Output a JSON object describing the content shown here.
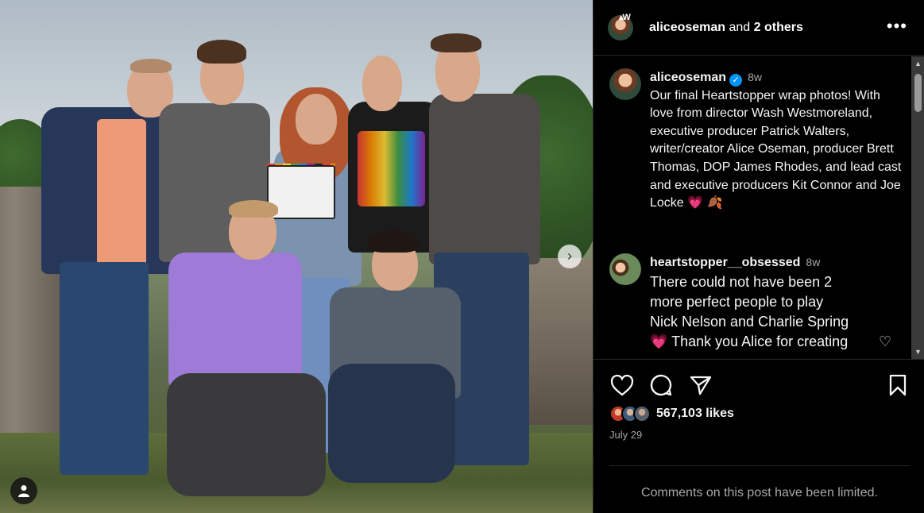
{
  "photo": {
    "next_button_icon": "chevron-right-icon",
    "tag_icon": "user-tag-icon"
  },
  "header": {
    "username": "aliceoseman",
    "joiner": " and ",
    "others": "2 others",
    "more_icon": "more-horizontal-icon"
  },
  "caption": {
    "username": "aliceoseman",
    "time": "8w",
    "text": "Our final Heartstopper wrap photos! With love from director Wash Westmoreland, executive producer Patrick Walters, writer/creator Alice Oseman, producer Brett Thomas, DOP James Rhodes, and lead cast and executive producers Kit Connor and Joe Locke",
    "emoji": "💗 🍂"
  },
  "comments": [
    {
      "username": "heartstopper__obsessed",
      "time": "8w",
      "text_lines": [
        "There could not have been 2",
        "more perfect people to play",
        "Nick Nelson and Charlie Spring",
        "💗 Thank you Alice for creating"
      ]
    }
  ],
  "actions": {
    "like_icon": "heart-icon",
    "comment_icon": "comment-icon",
    "share_icon": "send-icon",
    "save_icon": "bookmark-icon"
  },
  "likes": "567,103 likes",
  "date": "July 29",
  "limited_notice": "Comments on this post have been limited.",
  "colors": {
    "background": "#000000",
    "text": "#f5f5f5",
    "secondary_text": "#a8a8a8",
    "verified": "#0095f6",
    "divider": "#262626"
  }
}
